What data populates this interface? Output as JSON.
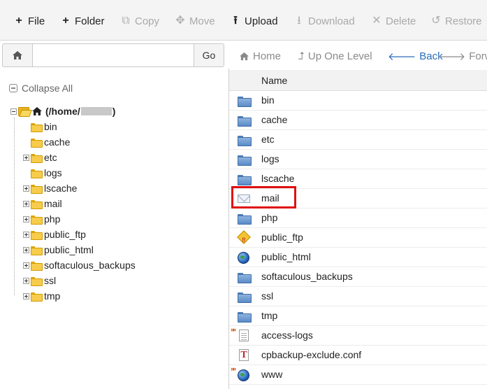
{
  "toolbar": {
    "file": "File",
    "folder": "Folder",
    "copy": "Copy",
    "move": "Move",
    "upload": "Upload",
    "download": "Download",
    "delete": "Delete",
    "restore": "Restore"
  },
  "pathbar": {
    "path_value": "",
    "go": "Go"
  },
  "nav": {
    "home": "Home",
    "up_one_level": "Up One Level",
    "back": "Back",
    "forward": "Forward"
  },
  "tree": {
    "collapse_all": "Collapse All",
    "root": "(/home/",
    "root_close": ")",
    "items": [
      {
        "label": "bin",
        "expandable": false
      },
      {
        "label": "cache",
        "expandable": false
      },
      {
        "label": "etc",
        "expandable": true
      },
      {
        "label": "logs",
        "expandable": false
      },
      {
        "label": "lscache",
        "expandable": true
      },
      {
        "label": "mail",
        "expandable": true
      },
      {
        "label": "php",
        "expandable": true
      },
      {
        "label": "public_ftp",
        "expandable": true
      },
      {
        "label": "public_html",
        "expandable": true
      },
      {
        "label": "softaculous_backups",
        "expandable": true
      },
      {
        "label": "ssl",
        "expandable": true
      },
      {
        "label": "tmp",
        "expandable": true
      }
    ]
  },
  "list": {
    "header_name": "Name",
    "rows": [
      {
        "name": "bin",
        "icon": "folder-icon"
      },
      {
        "name": "cache",
        "icon": "folder-icon"
      },
      {
        "name": "etc",
        "icon": "folder-icon"
      },
      {
        "name": "logs",
        "icon": "folder-icon"
      },
      {
        "name": "lscache",
        "icon": "folder-icon"
      },
      {
        "name": "mail",
        "icon": "envelope-icon"
      },
      {
        "name": "php",
        "icon": "folder-icon"
      },
      {
        "name": "public_ftp",
        "icon": "ftp-icon"
      },
      {
        "name": "public_html",
        "icon": "globe-icon"
      },
      {
        "name": "softaculous_backups",
        "icon": "folder-icon"
      },
      {
        "name": "ssl",
        "icon": "folder-icon"
      },
      {
        "name": "tmp",
        "icon": "folder-icon"
      },
      {
        "name": "access-logs",
        "icon": "symlink-document-icon"
      },
      {
        "name": "cpbackup-exclude.conf",
        "icon": "text-file-icon"
      },
      {
        "name": "www",
        "icon": "symlink-globe-icon"
      }
    ]
  },
  "colors": {
    "accent": "#2a6ebb",
    "highlight": "#e01010"
  }
}
